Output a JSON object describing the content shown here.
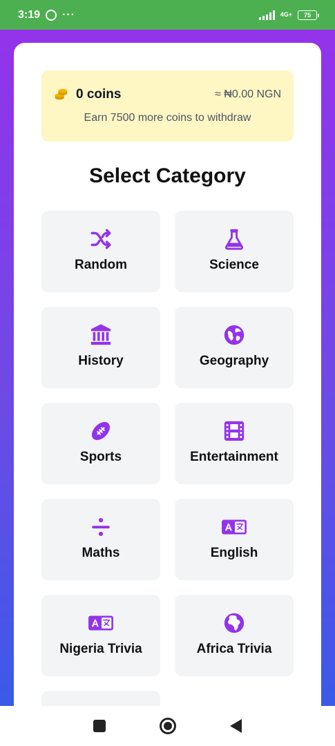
{
  "status_bar": {
    "time": "3:19",
    "dots": "···",
    "network": "4G+",
    "battery": "75"
  },
  "coins": {
    "count_label": "0 coins",
    "value_label": "≈ ₦0.00 NGN",
    "note": "Earn 7500 more coins to withdraw"
  },
  "page": {
    "title": "Select Category"
  },
  "categories": [
    {
      "label": "Random",
      "icon": "shuffle-icon"
    },
    {
      "label": "Science",
      "icon": "flask-icon"
    },
    {
      "label": "History",
      "icon": "landmark-icon"
    },
    {
      "label": "Geography",
      "icon": "globe-icon"
    },
    {
      "label": "Sports",
      "icon": "football-icon"
    },
    {
      "label": "Entertainment",
      "icon": "film-icon"
    },
    {
      "label": "Maths",
      "icon": "divide-icon"
    },
    {
      "label": "English",
      "icon": "language-icon"
    },
    {
      "label": "Nigeria Trivia",
      "icon": "language-icon"
    },
    {
      "label": "Africa Trivia",
      "icon": "globe-africa-icon"
    }
  ],
  "colors": {
    "accent": "#9333ea",
    "status_bar": "#4caf50",
    "coins_bg": "#fef6c3",
    "card_bg": "#f3f4f6"
  }
}
